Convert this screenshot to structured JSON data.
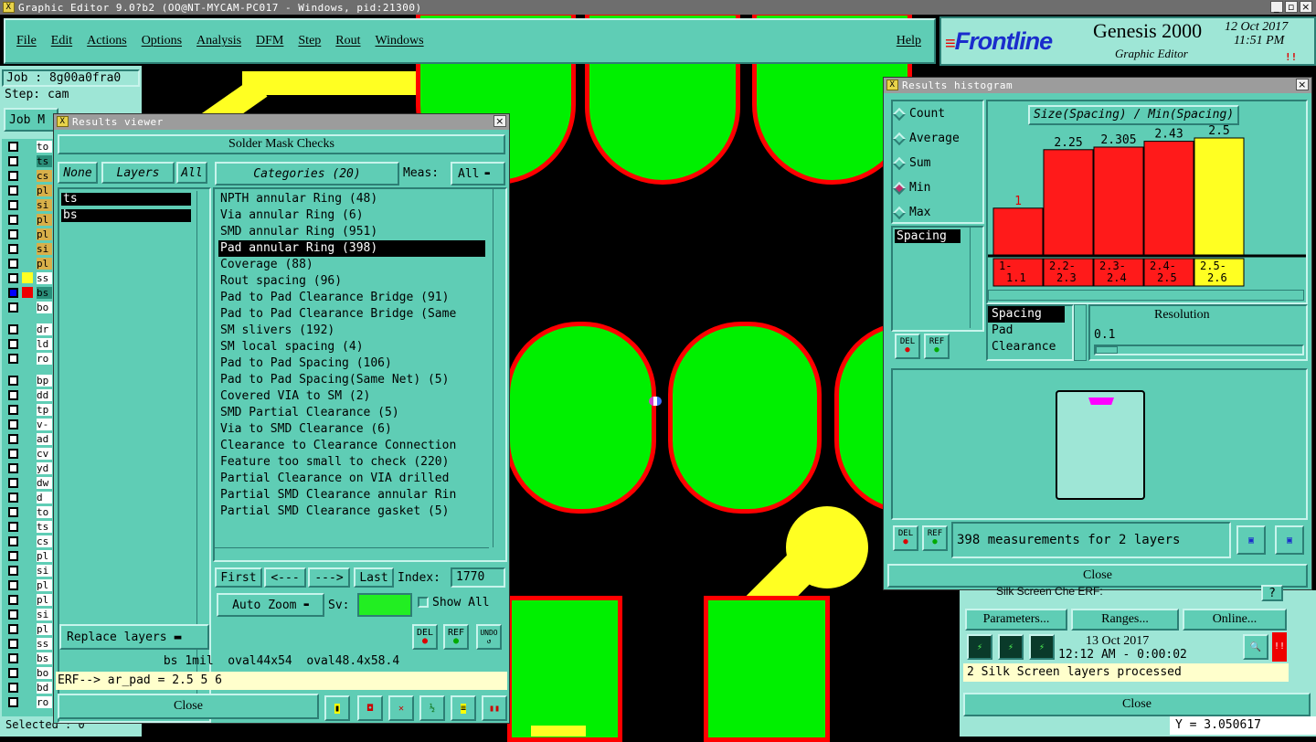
{
  "window": {
    "title": "Graphic Editor 9.0?b2 (OO@NT-MYCAM-PC017 - Windows, pid:21300)"
  },
  "menu": [
    "File",
    "Edit",
    "Actions",
    "Options",
    "Analysis",
    "DFM",
    "Step",
    "Rout",
    "Windows"
  ],
  "help": "Help",
  "brand": {
    "logo": "Frontline",
    "product": "Genesis 2000",
    "sub": "Graphic Editor",
    "date": "12 Oct 2017",
    "time": "11:51 PM",
    "alert": "!!"
  },
  "job": {
    "job": "Job : 8g00a0fra0",
    "step": "Step: cam",
    "jobm": "Job M"
  },
  "left_layers": {
    "group1": [
      "to",
      "ts",
      "cs",
      "pl",
      "si",
      "pl",
      "pl",
      "si",
      "pl",
      "ss",
      "bs",
      "bo"
    ],
    "group2": [
      "dr",
      "ld",
      "ro"
    ],
    "group3": [
      "bp",
      "dd",
      "tp",
      "v-",
      "ad",
      "cv",
      "yd",
      "dw",
      "d",
      "to",
      "ts",
      "cs",
      "pl",
      "si",
      "pl",
      "pl",
      "si",
      "pl",
      "ss",
      "bs",
      "bo",
      "bd",
      "ro"
    ],
    "selected": "Selected : 0"
  },
  "results_viewer": {
    "title": "Results viewer",
    "header": "Solder Mask Checks",
    "none": "None",
    "layers": "Layers",
    "all": "All",
    "layer_list": [
      "ts",
      "bs"
    ],
    "categories": "Categories (20)",
    "meas_label": "Meas:",
    "meas_value": "All",
    "items": [
      "NPTH annular Ring (48)",
      "Via annular Ring (6)",
      "SMD annular Ring (951)",
      "Pad annular Ring (398)",
      "Coverage (88)",
      "Rout spacing (96)",
      "Pad to Pad Clearance Bridge (91)",
      "Pad to Pad Clearance Bridge (Same",
      "SM slivers (192)",
      "SM local spacing (4)",
      "Pad to Pad Spacing (106)",
      "Pad to Pad Spacing(Same Net) (5)",
      "Covered VIA to SM (2)",
      "SMD Partial Clearance (5)",
      "Via to SMD Clearance (6)",
      "Clearance to Clearance Connection",
      "Feature too small to check (220)",
      "Partial Clearance on VIA drilled",
      "Partial SMD Clearance annular Rin",
      "Partial SMD Clearance gasket (5)"
    ],
    "selected_index": 3,
    "first": "First",
    "prev": "<---",
    "next": "--->",
    "last": "Last",
    "index_label": "Index:",
    "index_value": "1770",
    "autozoom": "Auto Zoom",
    "sv": "Sv:",
    "showall": "Show All",
    "replace": "Replace layers",
    "del": "DEL",
    "ref": "REF",
    "undo": "UNDO",
    "info": "bs 1mil  oval44x54  oval48.4x58.4",
    "erf": "ERF--> ar_pad = 2.5 5 6",
    "close": "Close"
  },
  "histogram": {
    "title": "Results histogram",
    "modes": [
      "Count",
      "Average",
      "Sum",
      "Min",
      "Max"
    ],
    "selected_mode": "Min",
    "chart_title": "Size(Spacing) / Min(Spacing)",
    "list1": [
      "Spacing"
    ],
    "list2": [
      "Spacing",
      "Pad",
      "Clearance"
    ],
    "resolution_label": "Resolution",
    "resolution_value": "0.1",
    "summary": "398 measurements for 2 layers",
    "del": "DEL",
    "ref": "REF",
    "close": "Close"
  },
  "chart_data": {
    "type": "bar",
    "title": "Size(Spacing) / Min(Spacing)",
    "categories": [
      "1-\n1.1",
      "2.2-\n2.3",
      "2.3-\n2.4",
      "2.4-\n2.5",
      "2.5-\n2.6"
    ],
    "category_lines": [
      [
        "1-",
        "1.1"
      ],
      [
        "2.2-",
        "2.3"
      ],
      [
        "2.3-",
        "2.4"
      ],
      [
        "2.4-",
        "2.5"
      ],
      [
        "2.5-",
        "2.6"
      ]
    ],
    "values": [
      1,
      2.25,
      2.305,
      2.43,
      2.5
    ],
    "labels": [
      "1",
      "2.25",
      "2.305",
      "2.43",
      "2.5"
    ],
    "colors": [
      "#ff1a1a",
      "#ff1a1a",
      "#ff1a1a",
      "#ff1a1a",
      "#ffff22"
    ],
    "ylim": [
      0,
      2.75
    ]
  },
  "silk": {
    "name": "Silk Screen Che",
    "erf": "ERF:",
    "parameters": "Parameters...",
    "ranges": "Ranges...",
    "online": "Online...",
    "date": "13 Oct 2017",
    "time": "12:12 AM - 0:00:02",
    "status": "2 Silk Screen layers processed",
    "close": "Close",
    "coord": "Y = 3.050617"
  }
}
